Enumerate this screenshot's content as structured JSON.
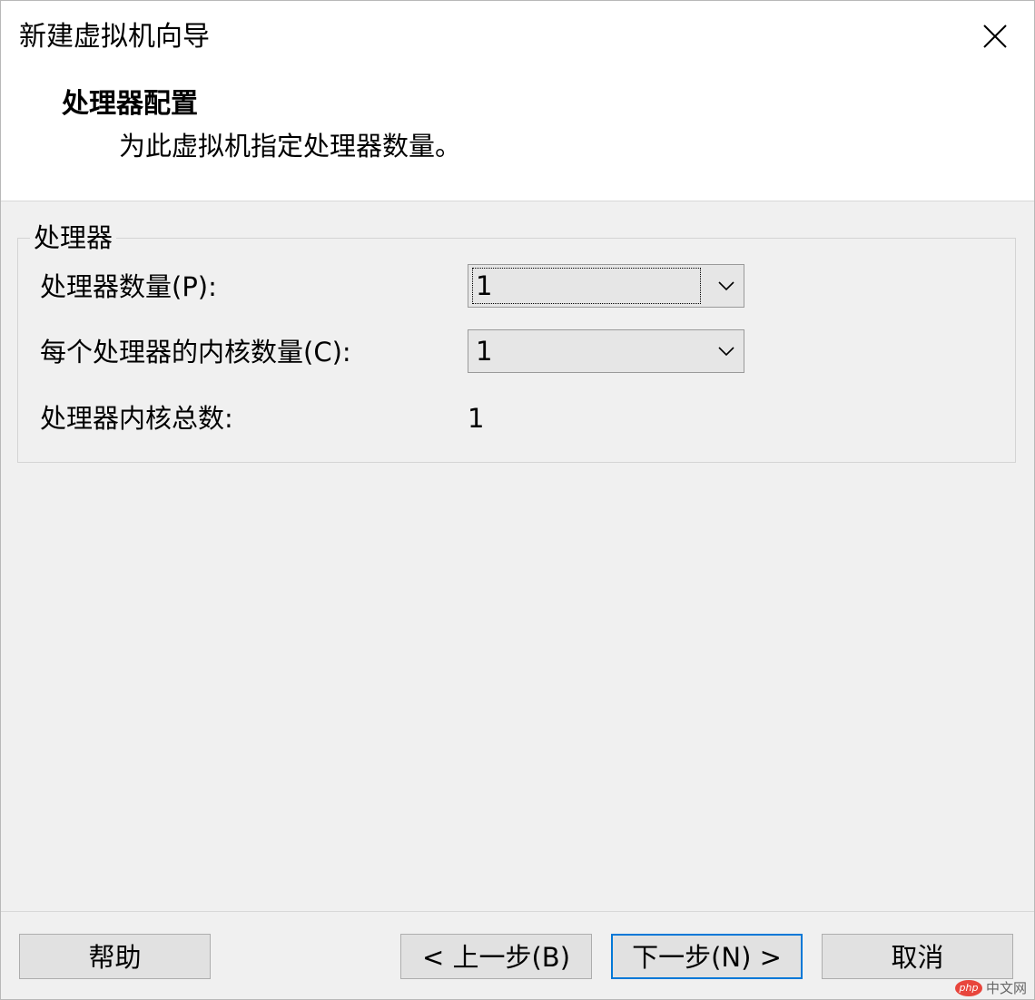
{
  "window": {
    "title": "新建虚拟机向导"
  },
  "header": {
    "title": "处理器配置",
    "subtitle": "为此虚拟机指定处理器数量。"
  },
  "processor_group": {
    "legend": "处理器",
    "num_processors": {
      "label": "处理器数量(P):",
      "value": "1"
    },
    "cores_per_processor": {
      "label": "每个处理器的内核数量(C):",
      "value": "1"
    },
    "total_cores": {
      "label": "处理器内核总数:",
      "value": "1"
    }
  },
  "footer": {
    "help_label": "帮助",
    "back_label": "< 上一步(B)",
    "next_label": "下一步(N) >",
    "cancel_label": "取消"
  },
  "watermark": {
    "badge": "php",
    "text": "中文网"
  },
  "icons": {
    "close": "close-icon",
    "dropdown": "chevron-down-icon"
  },
  "colors": {
    "focus_border": "#0078d7",
    "header_bg": "#ffffff",
    "body_bg": "#f0f0f0"
  }
}
